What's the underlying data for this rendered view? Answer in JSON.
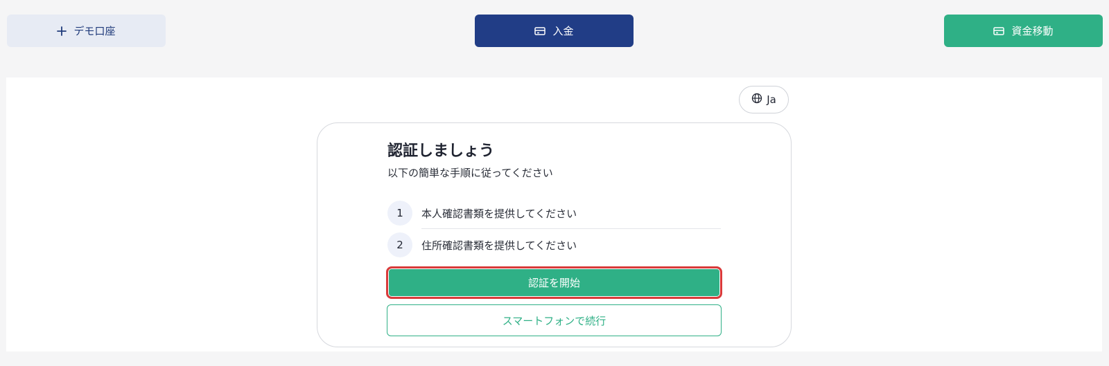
{
  "header": {
    "demo_account_label": "デモ口座",
    "deposit_label": "入金",
    "transfer_label": "資金移動"
  },
  "language": {
    "label": "Ja"
  },
  "verification": {
    "title": "認証しましょう",
    "subtitle": "以下の簡単な手順に従ってください",
    "steps": [
      {
        "number": "1",
        "text": "本人確認書類を提供してください"
      },
      {
        "number": "2",
        "text": "住所確認書類を提供してください"
      }
    ],
    "start_label": "認証を開始",
    "phone_label": "スマートフォンで続行"
  },
  "colors": {
    "primary_navy": "#213d86",
    "accent_green": "#2fb086",
    "highlight_red": "#d93a3a"
  },
  "icons": [
    "plus-icon",
    "card-icon",
    "globe-icon"
  ]
}
